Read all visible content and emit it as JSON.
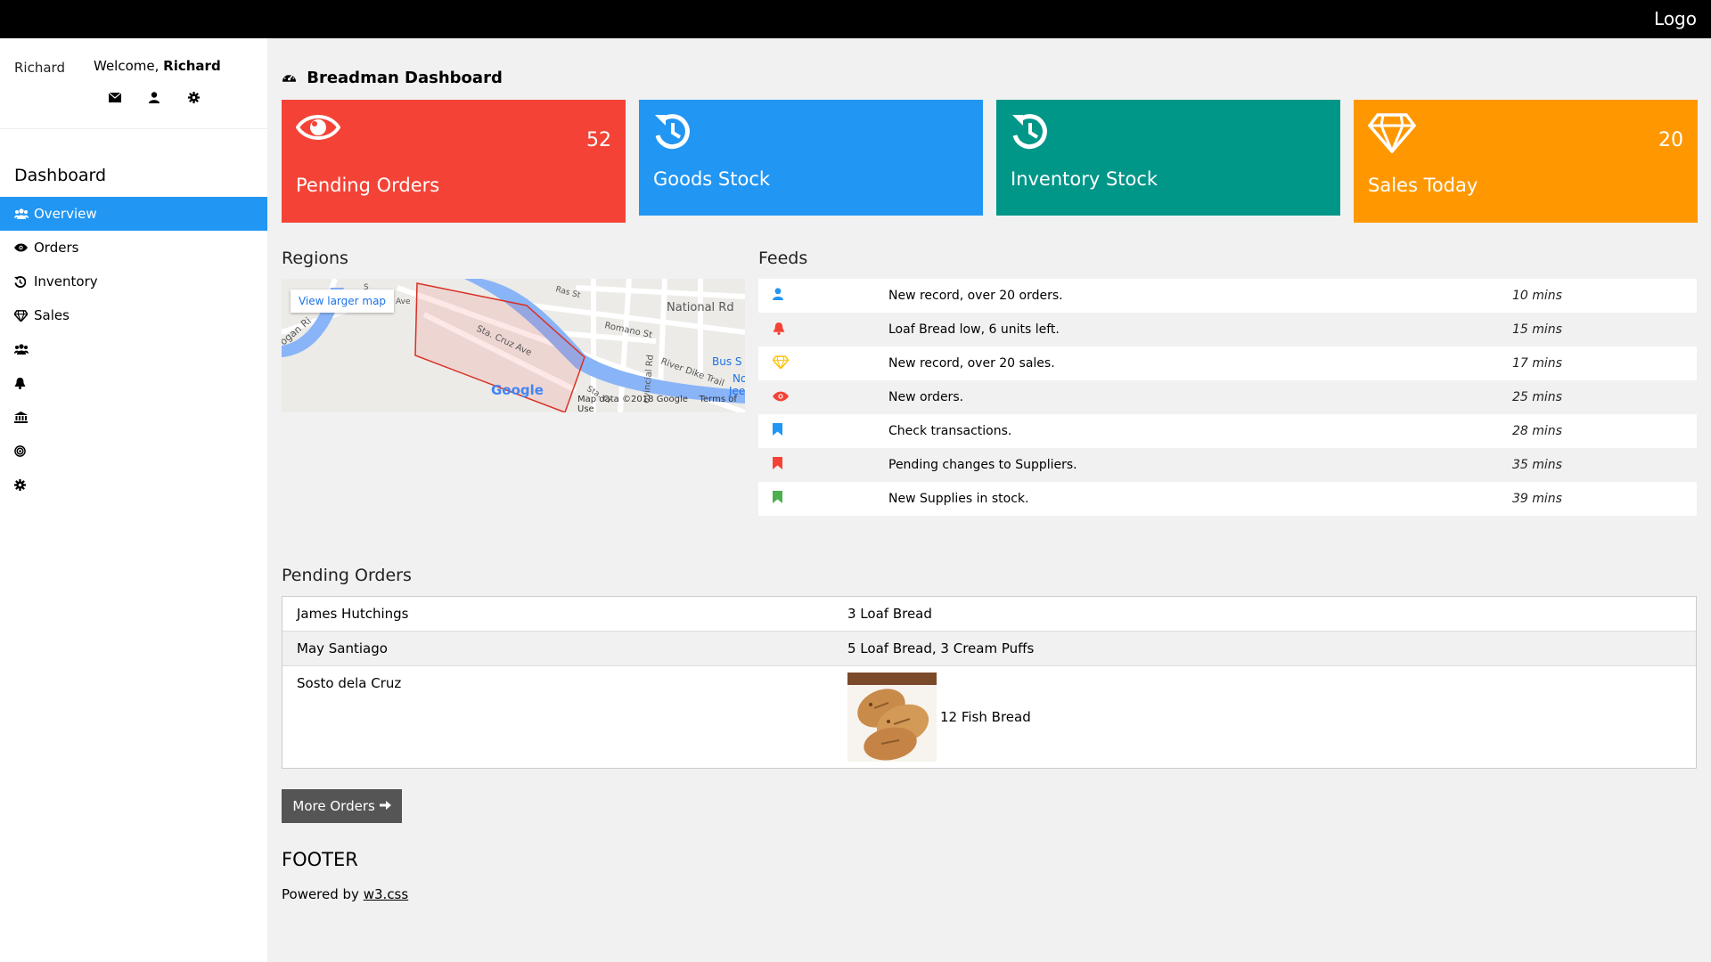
{
  "topbar": {
    "logo": "Logo"
  },
  "profile": {
    "avatar_alt": "Richard",
    "welcome": "Welcome,",
    "name": "Richard",
    "icons": [
      "envelope-icon",
      "user-icon",
      "cog-icon"
    ]
  },
  "sidebar": {
    "heading": "Dashboard",
    "items": [
      {
        "label": "Overview",
        "icon": "users-icon",
        "active": true
      },
      {
        "label": "Orders",
        "icon": "eye-icon"
      },
      {
        "label": "Inventory",
        "icon": "history-icon"
      },
      {
        "label": "Sales",
        "icon": "diamond-icon"
      },
      {
        "label": "",
        "icon": "users-icon"
      },
      {
        "label": "",
        "icon": "bell-icon"
      },
      {
        "label": "",
        "icon": "bank-icon"
      },
      {
        "label": "",
        "icon": "bullseye-icon"
      },
      {
        "label": "",
        "icon": "cog-icon"
      }
    ]
  },
  "dashboard": {
    "title": "Breadman Dashboard"
  },
  "cards": [
    {
      "label": "Pending Orders",
      "value": "52",
      "icon": "eye-icon",
      "color": "#f44336"
    },
    {
      "label": "Goods Stock",
      "value": "",
      "icon": "history-icon",
      "color": "#2196f3"
    },
    {
      "label": "Inventory Stock",
      "value": "",
      "icon": "history-icon",
      "color": "#009688"
    },
    {
      "label": "Sales Today",
      "value": "20",
      "icon": "diamond-icon",
      "color": "#ff9800"
    }
  ],
  "regions": {
    "title": "Regions",
    "map_link": "View larger map",
    "map_credit": "Map data ©2018 Google",
    "terms": "Terms of Use",
    "streets": [
      "National Rd",
      "Romano St",
      "River Dike Trail",
      "Sta. Cruz Ave",
      "Ras St",
      "ovincial Rd",
      "Bus S",
      "No",
      "Jee",
      "ogan Ri",
      "Sta. Cr",
      "Ave",
      "S"
    ],
    "google": "Google"
  },
  "feeds": {
    "title": "Feeds",
    "items": [
      {
        "icon": "user-icon",
        "color": "#2196f3",
        "text": "New record, over 20 orders.",
        "time": "10 mins"
      },
      {
        "icon": "bell-icon",
        "color": "#f44336",
        "text": "Loaf Bread low, 6 units left.",
        "time": "15 mins"
      },
      {
        "icon": "diamond-icon",
        "color": "#ffc107",
        "text": "New record, over 20 sales.",
        "time": "17 mins"
      },
      {
        "icon": "eye-icon",
        "color": "#f44336",
        "text": "New orders.",
        "time": "25 mins"
      },
      {
        "icon": "bookmark-icon",
        "color": "#2196f3",
        "text": "Check transactions.",
        "time": "28 mins"
      },
      {
        "icon": "bookmark-icon",
        "color": "#f44336",
        "text": "Pending changes to Suppliers.",
        "time": "35 mins"
      },
      {
        "icon": "bookmark-icon",
        "color": "#4caf50",
        "text": "New Supplies in stock.",
        "time": "39 mins"
      }
    ]
  },
  "pending": {
    "title": "Pending Orders",
    "rows": [
      {
        "name": "James Hutchings",
        "items": "3 Loaf Bread"
      },
      {
        "name": "May Santiago",
        "items": "5 Loaf Bread, 3 Cream Puffs"
      },
      {
        "name": "Sosto dela Cruz",
        "items": "12 Fish Bread"
      }
    ],
    "more_label": "More Orders"
  },
  "footer": {
    "title": "FOOTER",
    "powered": "Powered by",
    "link": "w3.css"
  }
}
